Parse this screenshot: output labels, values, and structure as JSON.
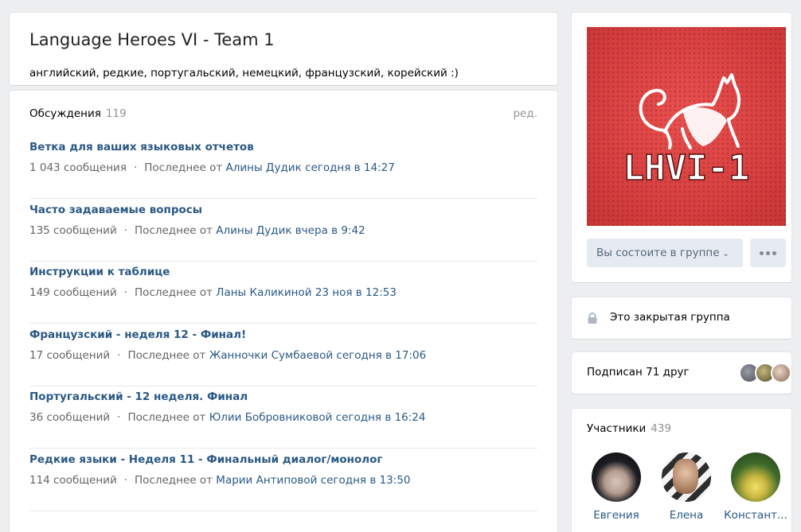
{
  "group": {
    "title": "Language Heroes VI - Team 1",
    "status": "английский, редкие, португальский, немецкий, французский, корейский :)"
  },
  "topics": {
    "title": "Обсуждения",
    "count": "119",
    "edit_label": "ред.",
    "items": [
      {
        "name": "Ветка для ваших языковых отчетов",
        "messages": "1 043 сообщения",
        "last_prefix": "Последнее от",
        "last": "Алины Дудик сегодня в 14:27"
      },
      {
        "name": "Часто задаваемые вопросы",
        "messages": "135 сообщений",
        "last_prefix": "Последнее от",
        "last": "Алины Дудик вчера в 9:42"
      },
      {
        "name": "Инструкции к таблице",
        "messages": "149 сообщений",
        "last_prefix": "Последнее от",
        "last": "Ланы Каликиной 23 ноя в 12:53"
      },
      {
        "name": "Французский - неделя 12 - Финал!",
        "messages": "17 сообщений",
        "last_prefix": "Последнее от",
        "last": "Жанночки Сумбаевой сегодня в 17:06"
      },
      {
        "name": "Португальский - 12 неделя. Финал",
        "messages": "36 сообщений",
        "last_prefix": "Последнее от",
        "last": "Юлии Бобровниковой сегодня в 16:24"
      },
      {
        "name": "Редкие языки - Неделя 11 - Финальный диалог/монолог",
        "messages": "114 сообщений",
        "last_prefix": "Последнее от",
        "last": "Марии Антиповой сегодня в 13:50"
      }
    ]
  },
  "cover": {
    "text": "LHVI-1",
    "bg_color": "#d84141"
  },
  "actions": {
    "member_label": "Вы состоите в группе",
    "chevron": "⌄",
    "more_icon": "more-dots-icon"
  },
  "closed": {
    "icon": "lock-icon",
    "label": "Это закрытая группа"
  },
  "friends": {
    "label": "Подписан 71 друг"
  },
  "members": {
    "title": "Участники",
    "count": "439",
    "items": [
      {
        "name": "Евгения"
      },
      {
        "name": "Елена"
      },
      {
        "name": "Констант..."
      }
    ]
  },
  "colors": {
    "link": "#2a5885",
    "muted": "#939393",
    "button_bg": "#e5ebf1",
    "page_bg": "#edeef0"
  }
}
